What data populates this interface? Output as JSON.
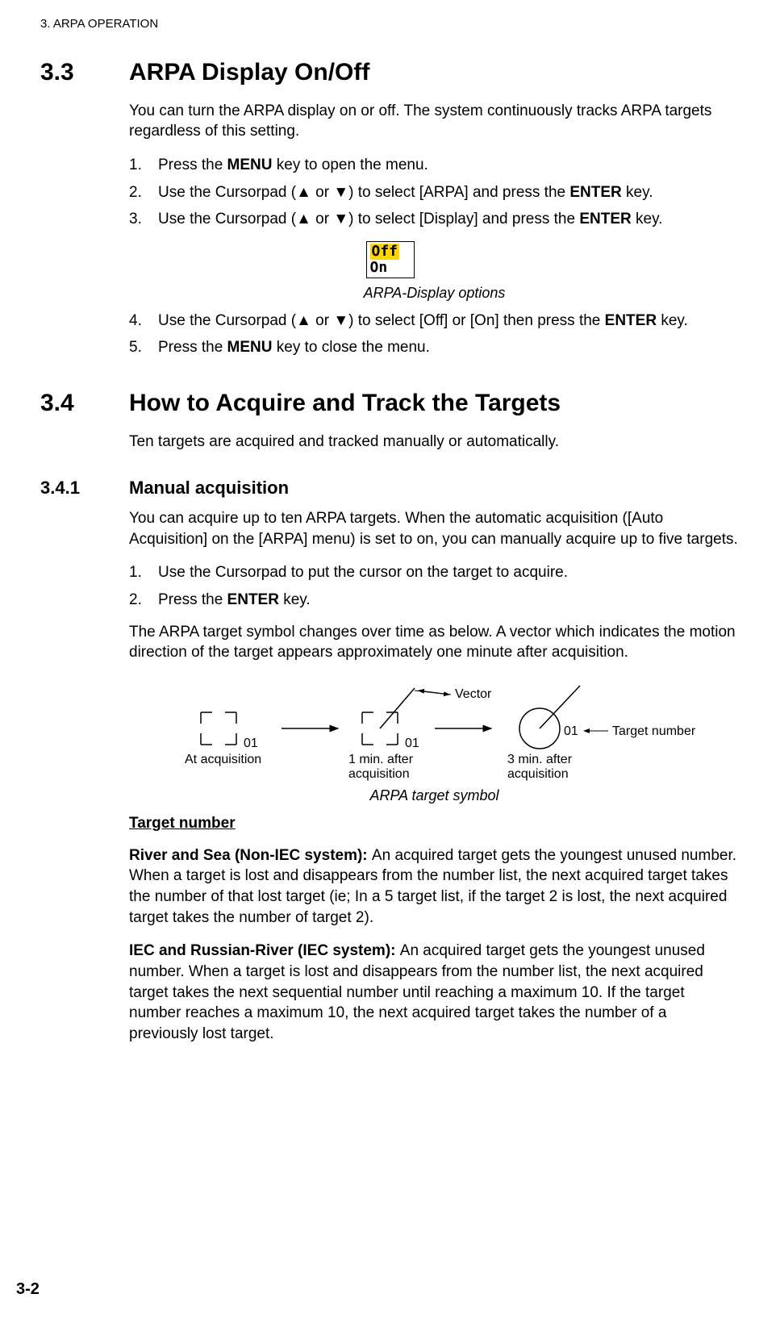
{
  "chapter_header": "3.  ARPA OPERATION",
  "s33": {
    "num": "3.3",
    "title": "ARPA Display On/Off",
    "intro": "You can turn the ARPA display on or off. The system continuously tracks ARPA targets regardless of this setting.",
    "step1_num": "1.",
    "step1_a": "Press the ",
    "step1_b": "MENU",
    "step1_c": " key to open the menu.",
    "step2_num": "2.",
    "step2_a": "Use the Cursorpad (▲ or ▼) to select [ARPA] and press the ",
    "step2_b": "ENTER",
    "step2_c": " key.",
    "step3_num": "3.",
    "step3_a": "Use the Cursorpad (▲ or ▼) to select [Display] and press the ",
    "step3_b": "ENTER",
    "step3_c": " key.",
    "opt_off": "Off",
    "opt_on": "On",
    "caption": "ARPA-Display options",
    "step4_num": "4.",
    "step4_a": "Use the Cursorpad (▲ or ▼) to select [Off] or [On] then press the ",
    "step4_b": "ENTER",
    "step4_c": " key.",
    "step5_num": "5.",
    "step5_a": "Press the ",
    "step5_b": "MENU",
    "step5_c": " key to close the menu."
  },
  "s34": {
    "num": "3.4",
    "title": "How to Acquire and Track the Targets",
    "intro": "Ten targets are acquired and tracked manually or automatically."
  },
  "s341": {
    "num": "3.4.1",
    "title": "Manual acquisition",
    "intro": "You can acquire up to ten ARPA targets. When the automatic acquisition ([Auto Acquisition] on the [ARPA] menu) is set to on, you can manually acquire up to five targets.",
    "step1_num": "1.",
    "step1": "Use the Cursorpad to put the cursor on the target to acquire.",
    "step2_num": "2.",
    "step2_a": "Press the ",
    "step2_b": "ENTER",
    "step2_c": " key.",
    "aftersteps": "The ARPA target symbol changes over time as below. A vector which indicates the motion direction of the target appears approximately one minute after acquisition.",
    "diagram": {
      "at_acq": "At acquisition",
      "one_min": "1 min. after\nacquisition",
      "three_min": "3 min. after\nacquisition",
      "vector": "Vector",
      "target_number": "Target number",
      "n01_1": "01",
      "n01_2": "01",
      "n01_3": "01"
    },
    "caption": "ARPA target symbol",
    "tn_heading": "Target number",
    "river_sea_b": "River and Sea (Non-IEC system): ",
    "river_sea": "An acquired target gets the youngest unused number. When a target is lost and disappears from the number list, the next acquired target takes the number of that lost target (ie; In a 5 target list, if the target 2 is lost, the next acquired target takes the number of target 2).",
    "iec_b": "IEC and Russian-River (IEC system): ",
    "iec": "An acquired target gets the youngest unused number. When a target is lost and disappears from the number list, the next acquired target takes the next sequential number until reaching a maximum 10. If the target number reaches a maximum 10, the next acquired target takes the number of a previously lost target."
  },
  "page_num": "3-2"
}
